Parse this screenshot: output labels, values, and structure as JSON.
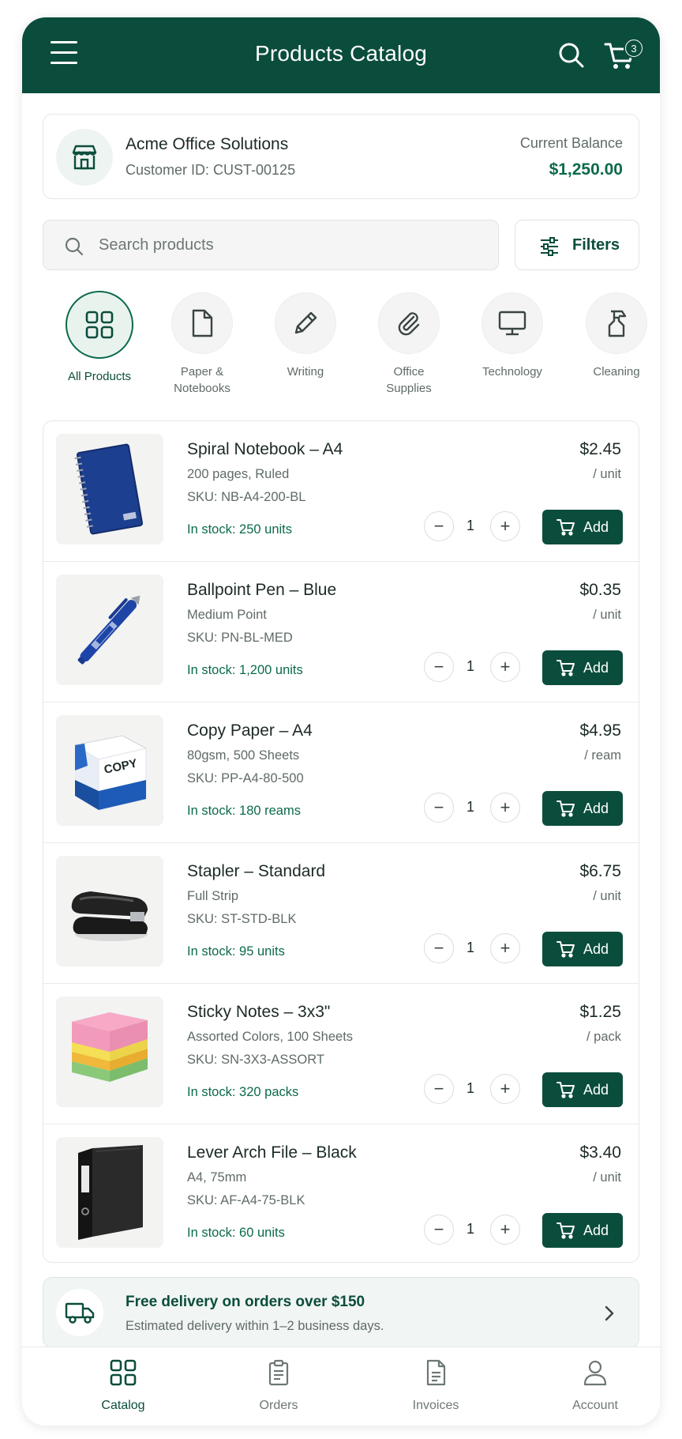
{
  "header": {
    "title": "Products Catalog",
    "cart_count": "3"
  },
  "customer": {
    "name": "Acme Office Solutions",
    "customer_id": "Customer ID: CUST-00125",
    "balance_label": "Current Balance",
    "balance_value": "$1,250.00"
  },
  "search": {
    "placeholder": "Search products",
    "value": ""
  },
  "filters": {
    "label": "Filters"
  },
  "categories": [
    {
      "label": "All Products",
      "icon": "grid-icon",
      "active": true
    },
    {
      "label": "Paper & Notebooks",
      "icon": "document-icon",
      "active": false
    },
    {
      "label": "Writing",
      "icon": "pencil-icon",
      "active": false
    },
    {
      "label": "Office Supplies",
      "icon": "paperclip-icon",
      "active": false
    },
    {
      "label": "Technology",
      "icon": "monitor-icon",
      "active": false
    },
    {
      "label": "Cleaning",
      "icon": "spray-bottle-icon",
      "active": false
    }
  ],
  "products": [
    {
      "name": "Spiral Notebook – A4",
      "desc": "200 pages, Ruled",
      "sku": "SKU: NB-A4-200-BL",
      "stock": "In stock: 250 units",
      "price": "$2.45",
      "unit": "/ unit",
      "qty": "1",
      "add": "Add",
      "image": "notebook"
    },
    {
      "name": "Ballpoint Pen – Blue",
      "desc": "Medium Point",
      "sku": "SKU: PN-BL-MED",
      "stock": "In stock: 1,200 units",
      "price": "$0.35",
      "unit": "/ unit",
      "qty": "1",
      "add": "Add",
      "image": "pen"
    },
    {
      "name": "Copy Paper – A4",
      "desc": "80gsm, 500 Sheets",
      "sku": "SKU: PP-A4-80-500",
      "stock": "In stock: 180 reams",
      "price": "$4.95",
      "unit": "/ ream",
      "qty": "1",
      "add": "Add",
      "image": "paper"
    },
    {
      "name": "Stapler – Standard",
      "desc": "Full Strip",
      "sku": "SKU: ST-STD-BLK",
      "stock": "In stock: 95 units",
      "price": "$6.75",
      "unit": "/ unit",
      "qty": "1",
      "add": "Add",
      "image": "stapler"
    },
    {
      "name": "Sticky Notes – 3x3\"",
      "desc": "Assorted Colors, 100 Sheets",
      "sku": "SKU: SN-3X3-ASSORT",
      "stock": "In stock: 320 packs",
      "price": "$1.25",
      "unit": "/ pack",
      "qty": "1",
      "add": "Add",
      "image": "sticky-notes"
    },
    {
      "name": "Lever Arch File – Black",
      "desc": "A4, 75mm",
      "sku": "SKU: AF-A4-75-BLK",
      "stock": "In stock: 60 units",
      "price": "$3.40",
      "unit": "/ unit",
      "qty": "1",
      "add": "Add",
      "image": "binder"
    }
  ],
  "product_images": {
    "paper_box_text": "COPY"
  },
  "delivery": {
    "title": "Free delivery on orders over $150",
    "subtitle": "Estimated delivery within 1–2 business days."
  },
  "bottom_nav": [
    {
      "label": "Catalog",
      "icon": "grid-icon",
      "active": true
    },
    {
      "label": "Orders",
      "icon": "clipboard-icon",
      "active": false
    },
    {
      "label": "Invoices",
      "icon": "invoice-icon",
      "active": false
    },
    {
      "label": "Account",
      "icon": "user-icon",
      "active": false
    }
  ],
  "colors": {
    "brand": "#0b4d3c",
    "accent_text": "#0b6a4c",
    "muted_text": "#5f6b67",
    "surface": "#f3f4f3"
  }
}
